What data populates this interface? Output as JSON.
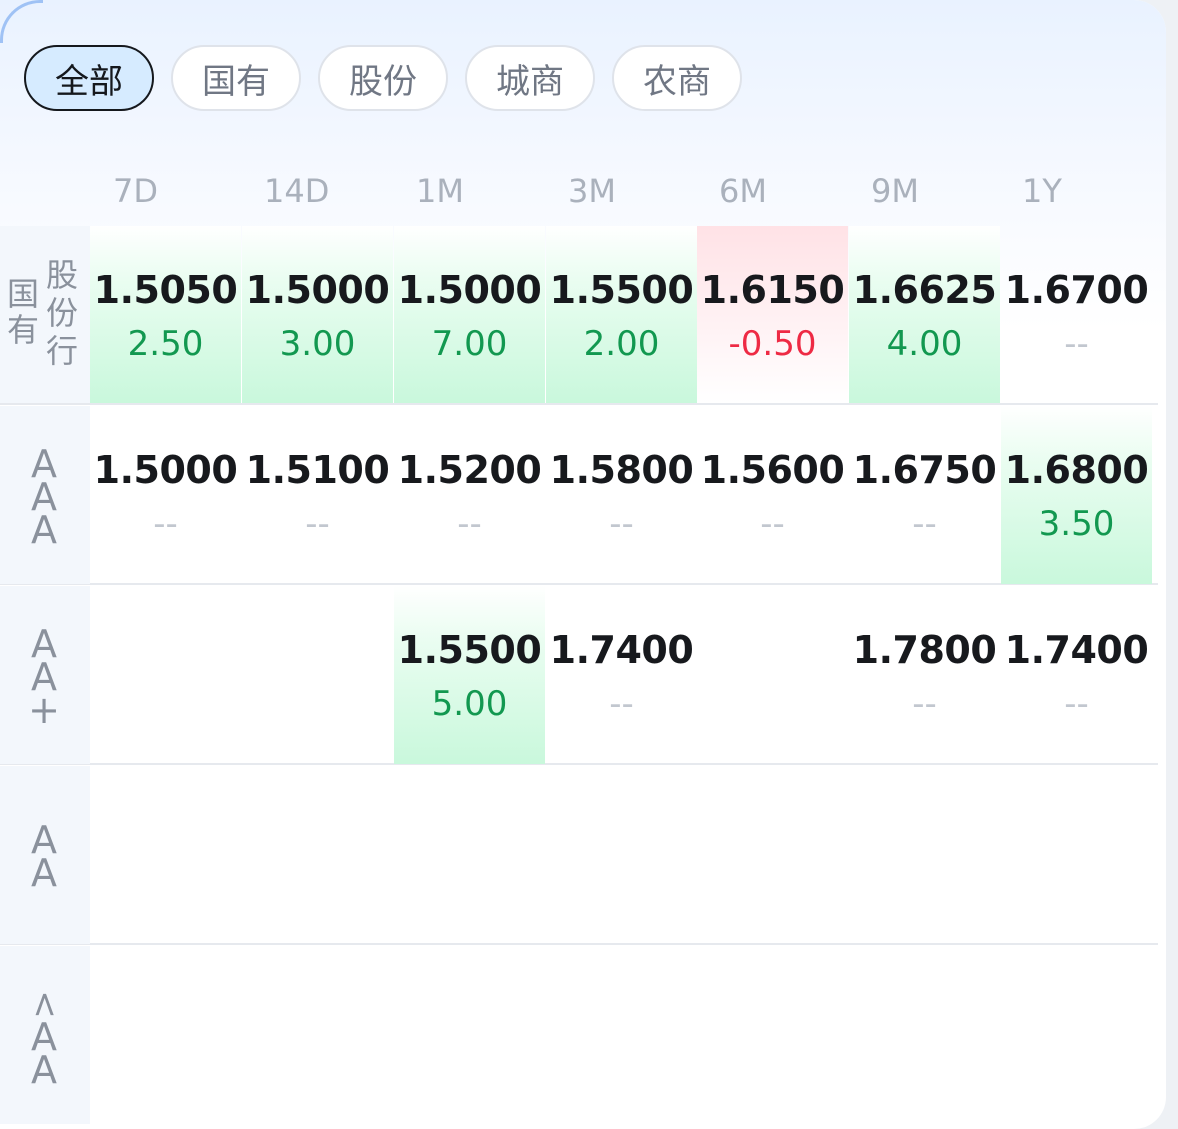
{
  "tabs": [
    {
      "label": "全部",
      "active": true
    },
    {
      "label": "国有",
      "active": false
    },
    {
      "label": "股份",
      "active": false
    },
    {
      "label": "城商",
      "active": false
    },
    {
      "label": "农商",
      "active": false
    }
  ],
  "columns": [
    "7D",
    "14D",
    "1M",
    "3M",
    "6M",
    "9M",
    "1Y"
  ],
  "rows": [
    {
      "label_lines": [
        "国有",
        "股份行"
      ],
      "cells": [
        {
          "rate": "1.5050",
          "change": "2.50",
          "trend": "up"
        },
        {
          "rate": "1.5000",
          "change": "3.00",
          "trend": "up"
        },
        {
          "rate": "1.5000",
          "change": "7.00",
          "trend": "up"
        },
        {
          "rate": "1.5500",
          "change": "2.00",
          "trend": "up"
        },
        {
          "rate": "1.6150",
          "change": "-0.50",
          "trend": "down"
        },
        {
          "rate": "1.6625",
          "change": "4.00",
          "trend": "up"
        },
        {
          "rate": "1.6700",
          "change": "--",
          "trend": "none"
        }
      ]
    },
    {
      "label_lines": [
        "A",
        "A",
        "A"
      ],
      "cells": [
        {
          "rate": "1.5000",
          "change": "--",
          "trend": "none"
        },
        {
          "rate": "1.5100",
          "change": "--",
          "trend": "none"
        },
        {
          "rate": "1.5200",
          "change": "--",
          "trend": "none"
        },
        {
          "rate": "1.5800",
          "change": "--",
          "trend": "none"
        },
        {
          "rate": "1.5600",
          "change": "--",
          "trend": "none"
        },
        {
          "rate": "1.6750",
          "change": "--",
          "trend": "none"
        },
        {
          "rate": "1.6800",
          "change": "3.50",
          "trend": "up"
        }
      ]
    },
    {
      "label_lines": [
        "A",
        "A",
        "+"
      ],
      "cells": [
        null,
        null,
        {
          "rate": "1.5500",
          "change": "5.00",
          "trend": "up"
        },
        {
          "rate": "1.7400",
          "change": "--",
          "trend": "none"
        },
        null,
        {
          "rate": "1.7800",
          "change": "--",
          "trend": "none"
        },
        {
          "rate": "1.7400",
          "change": "--",
          "trend": "none"
        }
      ]
    },
    {
      "label_lines": [
        "A",
        "A"
      ],
      "cells": [
        null,
        null,
        null,
        null,
        null,
        null,
        null
      ]
    },
    {
      "label_lines": [
        "<",
        "A",
        "A"
      ],
      "cells": [
        null,
        null,
        null,
        null,
        null,
        null,
        null
      ]
    }
  ],
  "colors": {
    "up": "#129850",
    "down": "#ee2a44",
    "neutral": "#c2c7cf",
    "active_tab_bg": "#d6ebff"
  }
}
